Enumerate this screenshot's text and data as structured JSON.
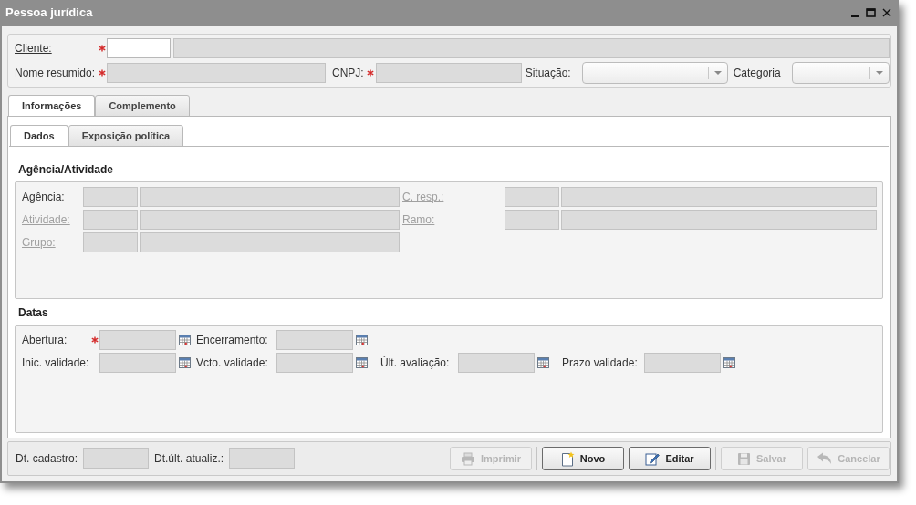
{
  "window": {
    "title": "Pessoa jurídica"
  },
  "header": {
    "cliente": {
      "label": "Cliente:",
      "link": true,
      "required": true
    },
    "nome_resumido": {
      "label": "Nome resumido:",
      "link": false,
      "required": true
    },
    "cnpj": {
      "label": "CNPJ:",
      "required": true
    },
    "situacao": {
      "label": "Situação:"
    },
    "categoria": {
      "label": "Categoria"
    }
  },
  "tabs": [
    {
      "label": "Informações",
      "selected": true
    },
    {
      "label": "Complemento",
      "selected": false
    }
  ],
  "subtabs": [
    {
      "label": "Dados",
      "selected": true
    },
    {
      "label": "Exposição política",
      "selected": false
    }
  ],
  "agencia_atividade": {
    "title": "Agência/Atividade",
    "left": [
      {
        "label": "Agência:",
        "link": false,
        "disabled": false
      },
      {
        "label": "Atividade:",
        "link": true,
        "disabled": true
      },
      {
        "label": "Grupo:",
        "link": true,
        "disabled": true
      }
    ],
    "right": [
      {
        "label": "C. resp.:",
        "link": true,
        "disabled": true
      },
      {
        "label": "Ramo:",
        "link": true,
        "disabled": true
      }
    ]
  },
  "datas": {
    "title": "Datas",
    "rows": [
      [
        {
          "label": "Abertura:",
          "required": true
        },
        {
          "label": "Encerramento:",
          "required": false
        }
      ],
      [
        {
          "label": "Inic. validade:",
          "required": false
        },
        {
          "label": "Vcto. validade:",
          "required": false
        },
        {
          "label": "Últ. avaliação:",
          "required": false
        },
        {
          "label": "Prazo validade:",
          "required": false
        }
      ]
    ]
  },
  "footer": {
    "dates": [
      {
        "label": "Dt. cadastro:"
      },
      {
        "label": "Dt.últ. atualiz.:"
      }
    ],
    "button_groups": [
      [
        {
          "label": "Imprimir",
          "kind": "print",
          "disabled": true
        }
      ],
      [
        {
          "label": "Novo",
          "kind": "new",
          "disabled": false
        },
        {
          "label": "Editar",
          "kind": "edit",
          "disabled": false
        }
      ],
      [
        {
          "label": "Salvar",
          "kind": "save",
          "disabled": true
        },
        {
          "label": "Cancelar",
          "kind": "cancel",
          "disabled": true
        }
      ]
    ]
  }
}
